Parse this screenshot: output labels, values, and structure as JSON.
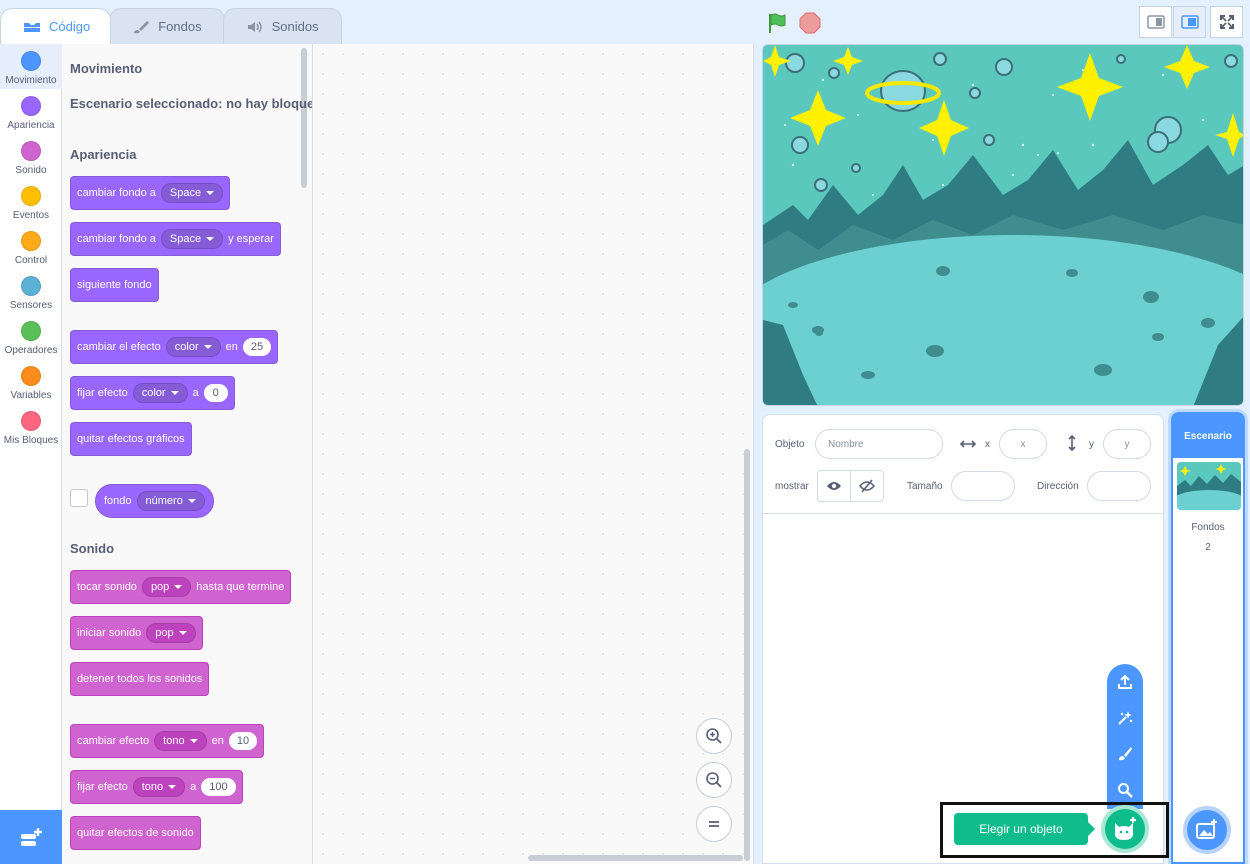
{
  "tabs": [
    {
      "label": "Código"
    },
    {
      "label": "Fondos"
    },
    {
      "label": "Sonidos"
    }
  ],
  "categories": [
    {
      "label": "Movimiento",
      "color": "#4c97ff"
    },
    {
      "label": "Apariencia",
      "color": "#9966ff"
    },
    {
      "label": "Sonido",
      "color": "#cf63cf"
    },
    {
      "label": "Eventos",
      "color": "#ffbf00"
    },
    {
      "label": "Control",
      "color": "#ffab19"
    },
    {
      "label": "Sensores",
      "color": "#5cb1d6"
    },
    {
      "label": "Operadores",
      "color": "#59c059"
    },
    {
      "label": "Variables",
      "color": "#ff8c1a"
    },
    {
      "label": "Mis Bloques",
      "color": "#ff6680"
    }
  ],
  "palette": {
    "motion_title": "Movimiento",
    "motion_note": "Escenario seleccionado: no hay bloques",
    "looks_title": "Apariencia",
    "sound_title": "Sonido",
    "b1": {
      "text": "cambiar fondo a",
      "drop": "Space"
    },
    "b2": {
      "text": "cambiar fondo a",
      "drop": "Space",
      "tail": "y esperar"
    },
    "b3": {
      "text": "siguiente fondo"
    },
    "b4": {
      "text": "cambiar el efecto",
      "drop": "color",
      "mid": "en",
      "num": "25"
    },
    "b5": {
      "text": "fijar efecto",
      "drop": "color",
      "mid": "a",
      "num": "0"
    },
    "b6": {
      "text": "quitar efectos gráficos"
    },
    "b7": {
      "text": "fondo",
      "drop": "número"
    },
    "s1": {
      "text": "tocar sonido",
      "drop": "pop",
      "tail": "hasta que termine"
    },
    "s2": {
      "text": "iniciar sonido",
      "drop": "pop"
    },
    "s3": {
      "text": "detener todos los sonidos"
    },
    "s4": {
      "text": "cambiar efecto",
      "drop": "tono",
      "mid": "en",
      "num": "10"
    },
    "s5": {
      "text": "fijar efecto",
      "drop": "tono",
      "mid": "a",
      "num": "100"
    },
    "s6": {
      "text": "quitar efectos de sonido"
    }
  },
  "sprite_info": {
    "object_label": "Objeto",
    "name_placeholder": "Nombre",
    "x_label": "x",
    "x_placeholder": "x",
    "y_label": "y",
    "y_placeholder": "y",
    "show_label": "mostrar",
    "size_label": "Tamaño",
    "direction_label": "Dirección"
  },
  "stage_selector": {
    "title": "Escenario",
    "backdrops_label": "Fondos",
    "backdrops_count": "2"
  },
  "tooltip": "Elegir un objeto",
  "icons": {
    "flag": "green-flag-icon",
    "stop": "stop-icon"
  }
}
